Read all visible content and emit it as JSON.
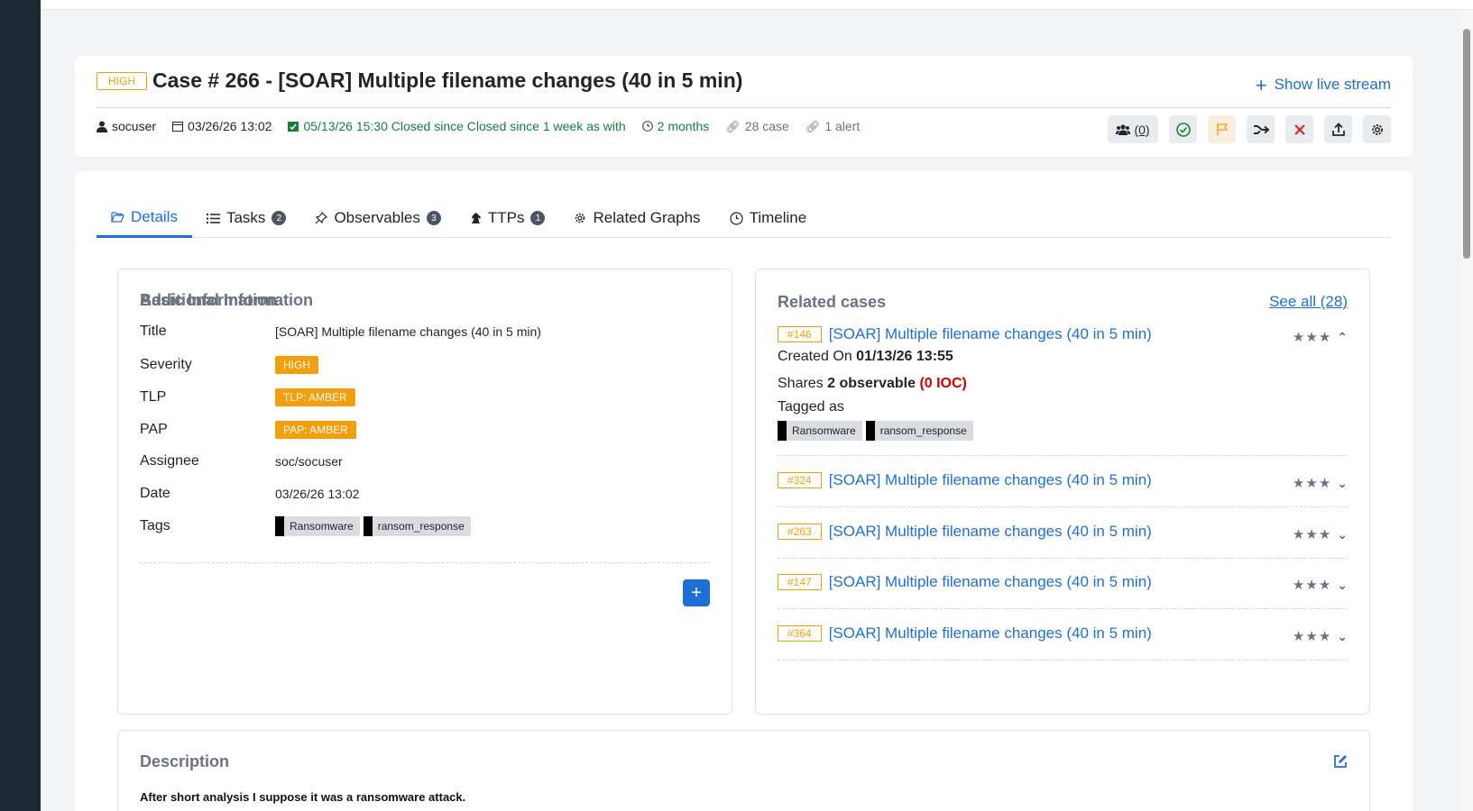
{
  "case": {
    "severity": "HIGH",
    "title": "Case # 266 - [SOAR] Multiple filename changes (40 in 5 min)",
    "live_stream": "Show live stream",
    "owner": "socuser",
    "created": "03/26/26 13:02",
    "closed": "05/13/26 15:30 Closed since Closed since 1 week as  with",
    "duration": "2 months",
    "case_links": "28 case",
    "alerts": "1 alert",
    "sharing_count": "(0)"
  },
  "tabs": [
    {
      "label": "Details",
      "count": ""
    },
    {
      "label": "Tasks",
      "count": "2"
    },
    {
      "label": "Observables",
      "count": "3"
    },
    {
      "label": "TTPs",
      "count": "1"
    },
    {
      "label": "Related Graphs",
      "count": ""
    },
    {
      "label": "Timeline",
      "count": ""
    }
  ],
  "basic": {
    "heading": "Basic Information",
    "title_label": "Title",
    "title_value": "[SOAR] Multiple filename changes (40 in 5 min)",
    "severity_label": "Severity",
    "severity_value": "HIGH",
    "tlp_label": "TLP",
    "tlp_value": "TLP: AMBER",
    "pap_label": "PAP",
    "pap_value": "PAP: AMBER",
    "assignee_label": "Assignee",
    "assignee_value": "soc/socuser",
    "date_label": "Date",
    "date_value": "03/26/26 13:02",
    "tags_label": "Tags",
    "tags": [
      "Ransomware",
      "ransom_response"
    ],
    "additional_heading": "Additional Information"
  },
  "related": {
    "heading": "Related cases",
    "see_all": "See all (28)",
    "cases": [
      {
        "id": "#146",
        "title": "[SOAR] Multiple filename changes (40 in 5 min)"
      },
      {
        "id": "#324",
        "title": "[SOAR] Multiple filename changes (40 in 5 min)"
      },
      {
        "id": "#263",
        "title": "[SOAR] Multiple filename changes (40 in 5 min)"
      },
      {
        "id": "#147",
        "title": "[SOAR] Multiple filename changes (40 in 5 min)"
      },
      {
        "id": "#364",
        "title": "[SOAR] Multiple filename changes (40 in 5 min)"
      }
    ],
    "expanded": {
      "created_label": "Created On",
      "created_value": "01/13/26 13:55",
      "shares_label": "Shares",
      "shares_value": "2 observable",
      "ioc": "(0 IOC)",
      "tagged_label": "Tagged as",
      "tags": [
        "Ransomware",
        "ransom_response"
      ]
    }
  },
  "description": {
    "heading": "Description",
    "text": "After short analysis I suppose it was a ransomware attack."
  },
  "colors": {
    "accent": "#1e6fd9",
    "severity": "#f59e0b",
    "closed": "#15803d",
    "ioc": "#cc0000",
    "sidebar": "#1f2933"
  }
}
